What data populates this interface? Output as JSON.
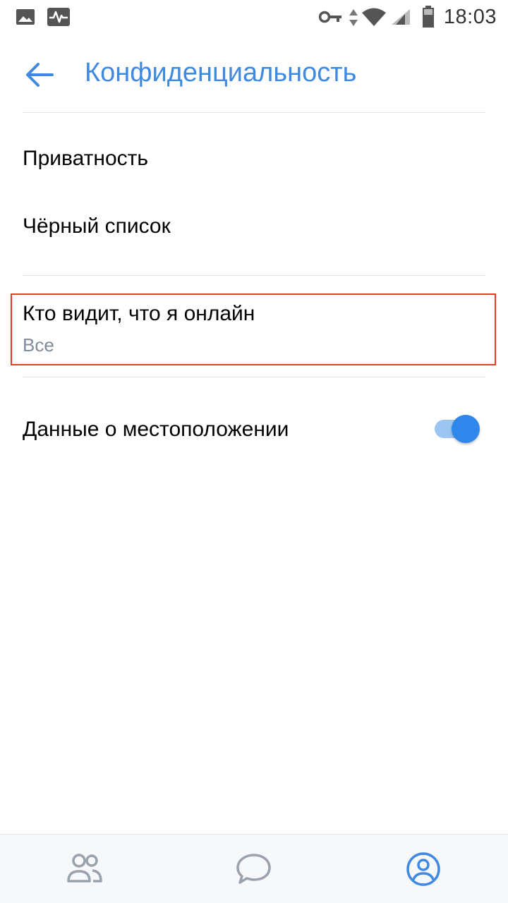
{
  "status_bar": {
    "time": "18:03",
    "left_icons": [
      "image-notification-icon",
      "activity-notification-icon"
    ],
    "right_icons": [
      "vpn-key-icon",
      "data-arrows-icon",
      "wifi-icon",
      "signal-icon",
      "battery-icon"
    ]
  },
  "header": {
    "title": "Конфиденциальность",
    "back_icon": "arrow-left-icon",
    "accent_color": "#3f8ae0"
  },
  "settings": {
    "privacy_label": "Приватность",
    "blacklist_label": "Чёрный список",
    "online_visibility": {
      "label": "Кто видит, что я онлайн",
      "value": "Все"
    },
    "location": {
      "label": "Данные о местоположении",
      "enabled": true
    }
  },
  "bottom_nav": {
    "tabs": [
      {
        "icon": "friends-icon",
        "active": false
      },
      {
        "icon": "messages-icon",
        "active": false
      },
      {
        "icon": "profile-icon",
        "active": true
      }
    ],
    "active_color": "#3f8ae0",
    "inactive_color": "#99a2ad"
  },
  "colors": {
    "highlight_border": "#e53a24",
    "toggle_on": "#2f86eb"
  }
}
